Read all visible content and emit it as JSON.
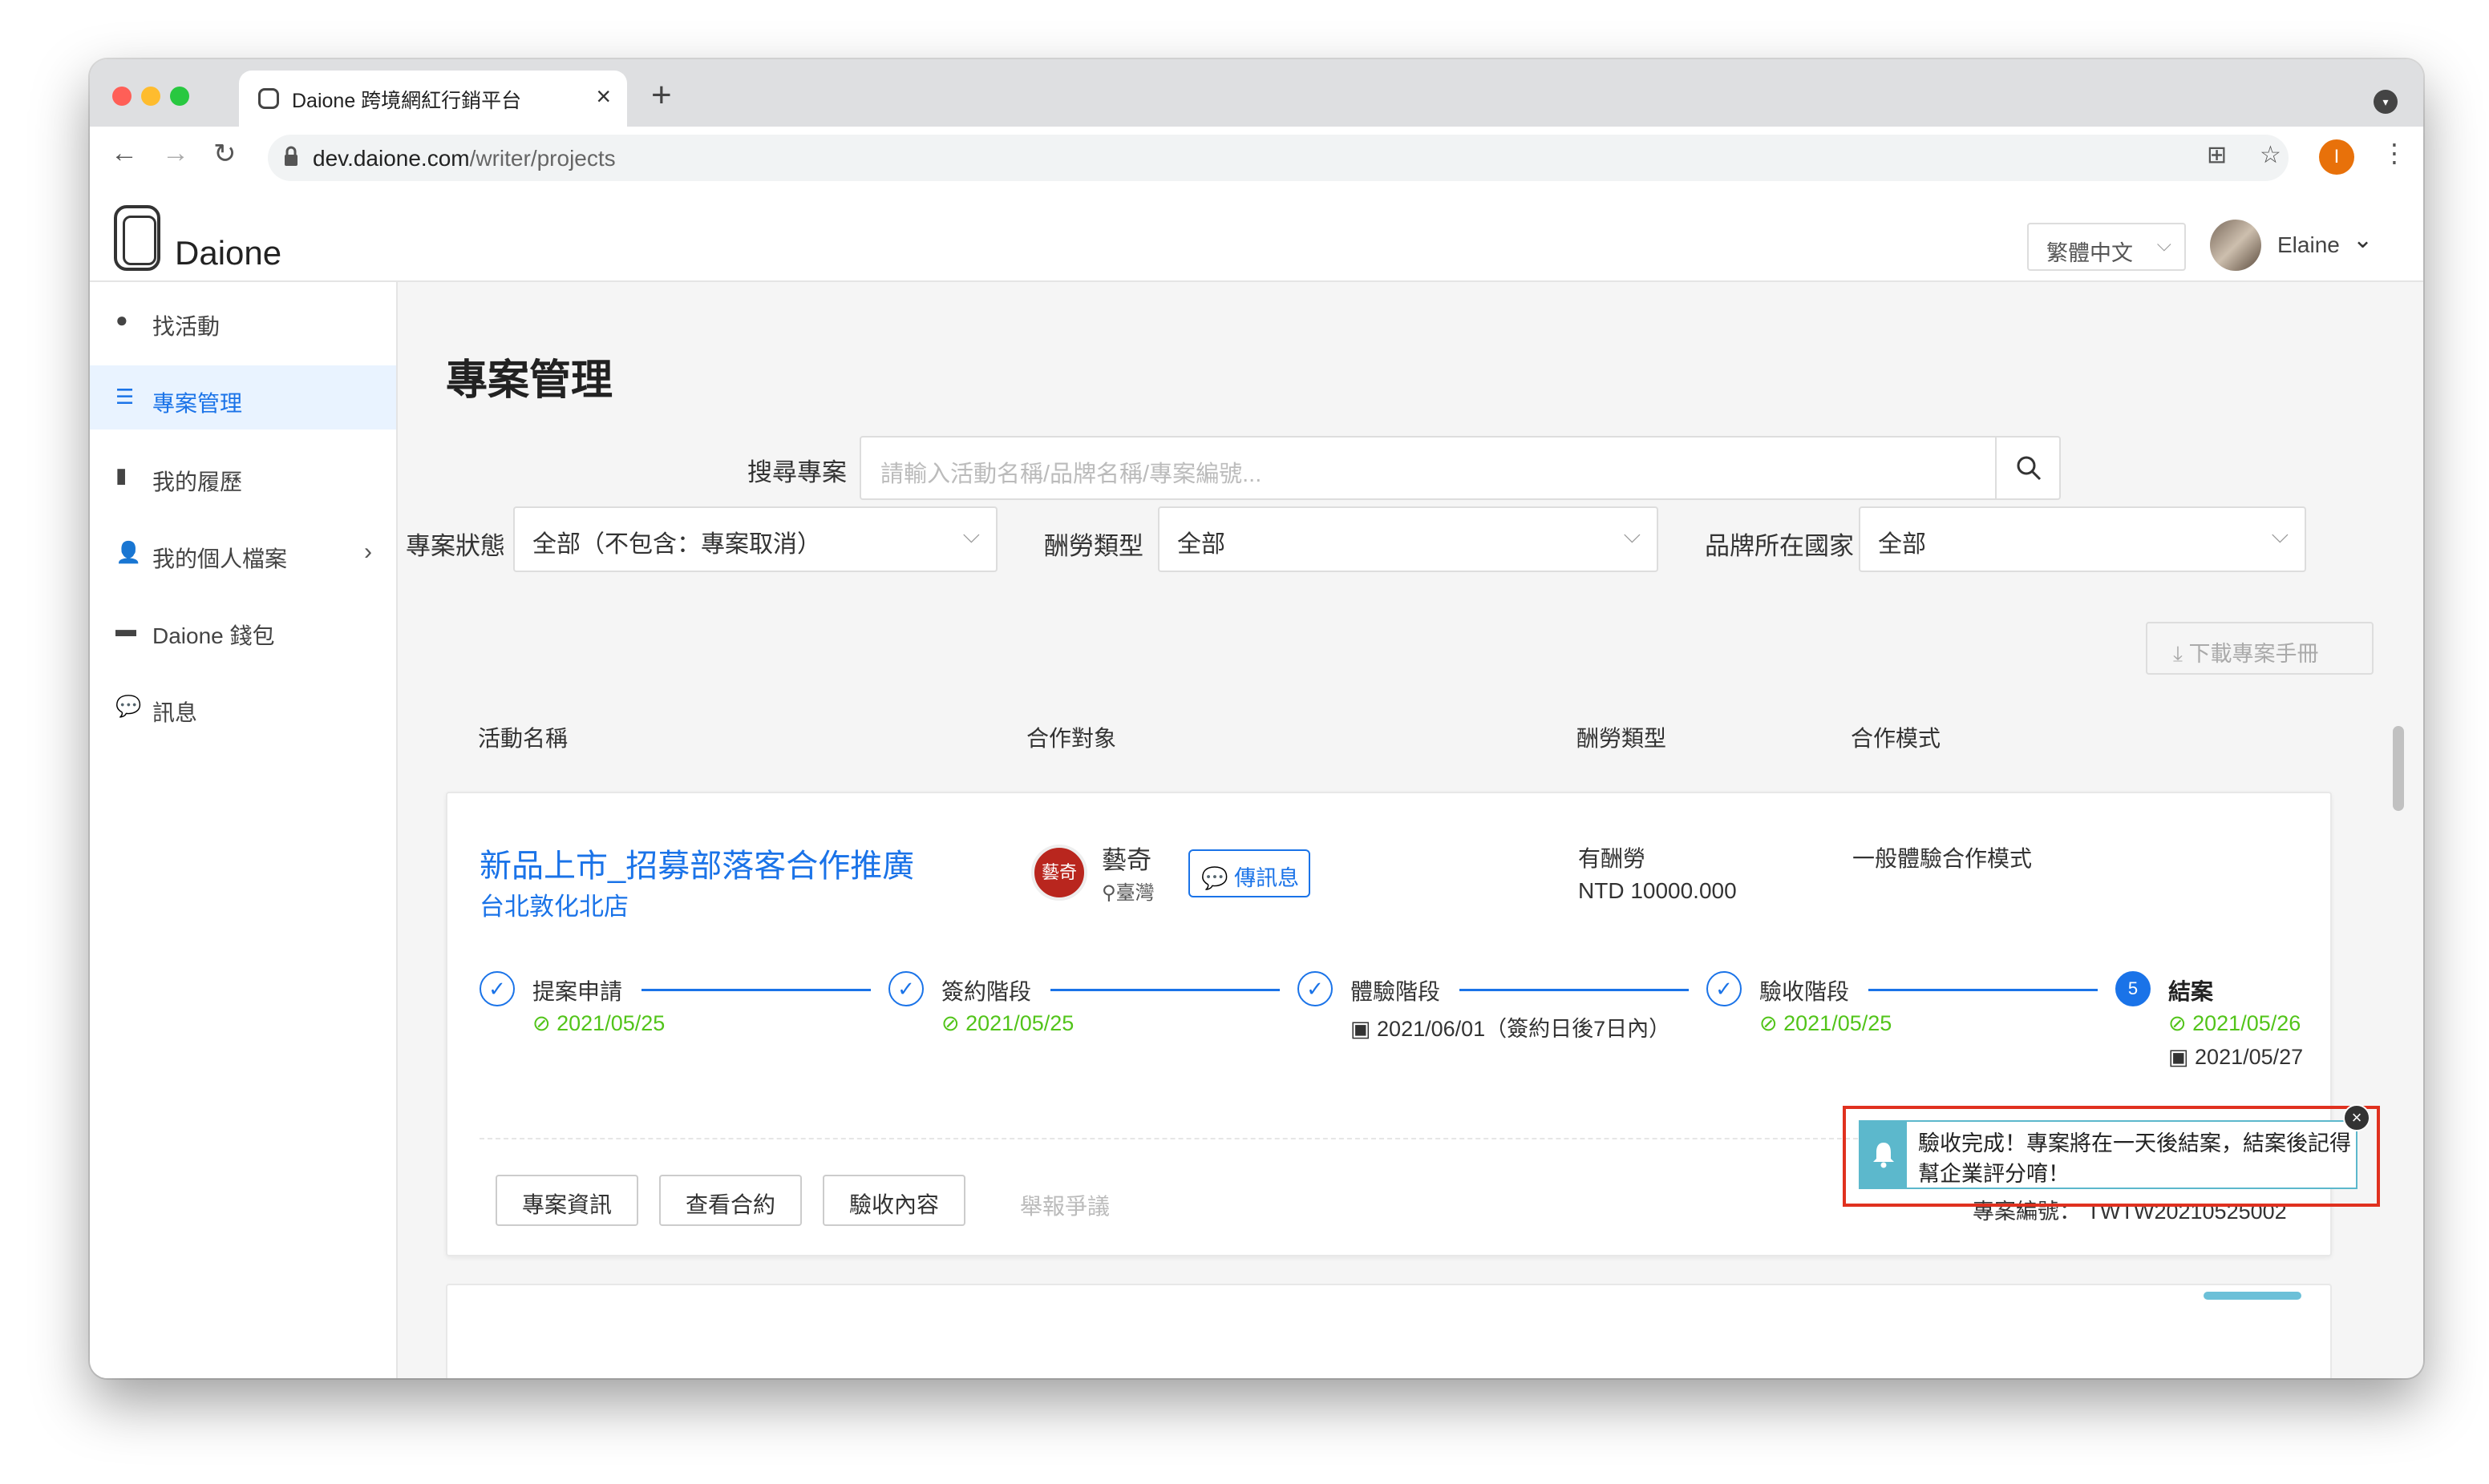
{
  "browser": {
    "tab_title": "Daione 跨境網紅行銷平台",
    "tab_close": "×",
    "new_tab": "+",
    "url_domain": "dev.daione.com",
    "url_path": "/writer/projects",
    "profile_initial": "I"
  },
  "app": {
    "logo_text": "Daione",
    "language": "繁體中文",
    "user_name": "Elaine"
  },
  "sidebar": {
    "items": [
      {
        "label": "找活動",
        "icon": "lightbulb-icon"
      },
      {
        "label": "專案管理",
        "icon": "list-icon",
        "active": true
      },
      {
        "label": "我的履歷",
        "icon": "document-icon"
      },
      {
        "label": "我的個人檔案",
        "icon": "user-icon"
      },
      {
        "label": "Daione 錢包",
        "icon": "wallet-icon"
      },
      {
        "label": "訊息",
        "icon": "chat-icon"
      }
    ]
  },
  "main": {
    "title": "專案管理",
    "search_label": "搜尋專案",
    "search_placeholder": "請輸入活動名稱/品牌名稱/專案編號...",
    "filters": {
      "status_label": "專案狀態",
      "status_value": "全部（不包含：專案取消）",
      "pay_label": "酬勞類型",
      "pay_value": "全部",
      "country_label": "品牌所在國家",
      "country_value": "全部"
    },
    "download_label": "下載專案手冊",
    "table_headers": [
      "活動名稱",
      "合作對象",
      "酬勞類型",
      "合作模式"
    ]
  },
  "project": {
    "title": "新品上市_招募部落客合作推廣",
    "store": "台北敦化北店",
    "partner_name": "藝奇",
    "partner_avatar_text": "藝奇",
    "partner_location": "臺灣",
    "message_button": "傳訊息",
    "pay_type": "有酬勞",
    "pay_amount": "NTD 10000.000",
    "coop_mode": "一般體驗合作模式",
    "steps": [
      {
        "name": "提案申請",
        "date": "2021/05/25"
      },
      {
        "name": "簽約階段",
        "date": "2021/05/25"
      },
      {
        "name": "體驗階段",
        "date": "2021/06/01（簽約日後7日內）"
      },
      {
        "name": "驗收階段",
        "date": "2021/05/25"
      },
      {
        "name": "結案",
        "number": "5",
        "date": "2021/05/26",
        "date2": "2021/05/27"
      }
    ],
    "buttons": {
      "info": "專案資訊",
      "contract": "查看合約",
      "review": "驗收內容",
      "report": "舉報爭議"
    },
    "project_no_label": "專案編號：",
    "project_no": "TWTW20210525002",
    "notice": "驗收完成！專案將在一天後結案，結案後記得幫企業評分唷！"
  },
  "colors": {
    "accent": "#1a73e8",
    "success": "#52c41a",
    "notice_border": "#e0311f",
    "notice_accent": "#5cb8cc"
  }
}
